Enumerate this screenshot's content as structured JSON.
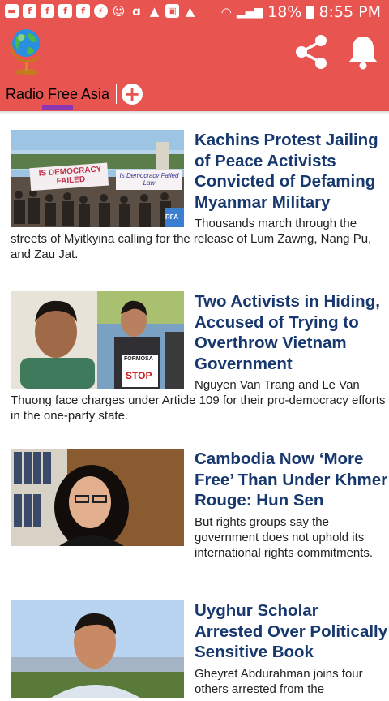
{
  "status_bar": {
    "left_icons": [
      "messages-icon",
      "facebook-icon",
      "facebook-icon",
      "facebook-icon",
      "facebook-icon",
      "messenger-icon",
      "cat-icon",
      "app-icon",
      "warning-icon",
      "image-icon",
      "warning-icon"
    ],
    "battery": "18%",
    "time": "8:55 PM"
  },
  "app_bar": {
    "logo": "globe-icon",
    "actions": [
      "share-icon",
      "bell-icon"
    ]
  },
  "tabs": {
    "items": [
      {
        "label": "Radio Free Asia",
        "selected": true
      }
    ],
    "add_icon": "plus-icon"
  },
  "articles": [
    {
      "headline": "Kachins Protest Jailing of Peace Activists Convicted of Defaming Myanmar Military",
      "summary": "Thousands march through the streets of Myitkyina calling for the release of Lum Zawng, Nang Pu, and Zau Jat.",
      "image_signs": [
        "IS DEMOCRACY FAILED",
        "Is Democracy Failed Law"
      ],
      "image_badge": "RFA"
    },
    {
      "headline": "Two Activists in Hiding, Accused of Trying to Overthrow Vietnam Government",
      "summary": "Nguyen Van Trang and Le Van Thuong face charges under Article 109 for their pro-democracy efforts in the one-party state.",
      "image_signs": [
        "FORMOSA",
        "STOP"
      ]
    },
    {
      "headline": "Cambodia Now ‘More Free’ Than Under Khmer Rouge: Hun Sen",
      "summary": "But rights groups say the government does not uphold its international rights commitments."
    },
    {
      "headline": "Uyghur Scholar Arrested Over Politically Sensitive Book",
      "summary": "Gheyret Abdurahman joins four others arrested from the"
    }
  ],
  "colors": {
    "primary": "#e85450",
    "headline": "#17386e",
    "tab_indicator": "#8b35b0"
  }
}
